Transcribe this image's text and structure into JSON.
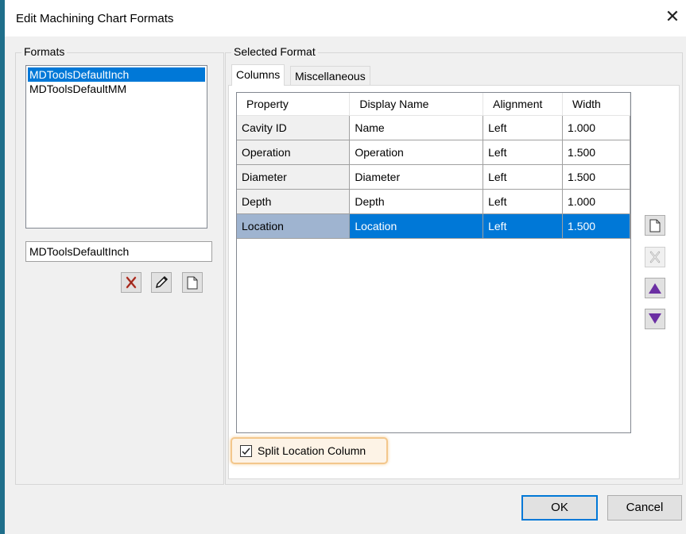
{
  "window": {
    "title": "Edit Machining Chart Formats",
    "close_glyph": "✕"
  },
  "formats": {
    "label": "Formats",
    "items": [
      "MDToolsDefaultInch",
      "MDToolsDefaultMM"
    ],
    "selected_index": 0,
    "name_value": "MDToolsDefaultInch",
    "buttons": [
      "delete-icon",
      "edit-pencil-icon",
      "new-document-icon"
    ]
  },
  "selected_format": {
    "label": "Selected Format",
    "tabs": [
      {
        "label": "Columns",
        "active": true
      },
      {
        "label": "Miscellaneous",
        "active": false
      }
    ],
    "columns_header": [
      "Property",
      "Display Name",
      "Alignment",
      "Width"
    ],
    "rows": [
      {
        "property": "Cavity ID",
        "display": "Name",
        "align": "Left",
        "width": "1.000"
      },
      {
        "property": "Operation",
        "display": "Operation",
        "align": "Left",
        "width": "1.500"
      },
      {
        "property": "Diameter",
        "display": "Diameter",
        "align": "Left",
        "width": "1.500"
      },
      {
        "property": "Depth",
        "display": "Depth",
        "align": "Left",
        "width": "1.000"
      },
      {
        "property": "Location",
        "display": "Location",
        "align": "Left",
        "width": "1.500"
      }
    ],
    "selected_row": 4,
    "side_buttons": [
      "new-document-icon",
      "delete-icon",
      "move-up-icon",
      "move-down-icon"
    ],
    "split_checkbox": {
      "label": "Split Location Column",
      "checked": true
    }
  },
  "footer": {
    "ok_label": "OK",
    "cancel_label": "Cancel"
  },
  "colors": {
    "selection": "#0078d7",
    "highlight": "#f3c78c",
    "arrow": "#6b2fa3"
  }
}
